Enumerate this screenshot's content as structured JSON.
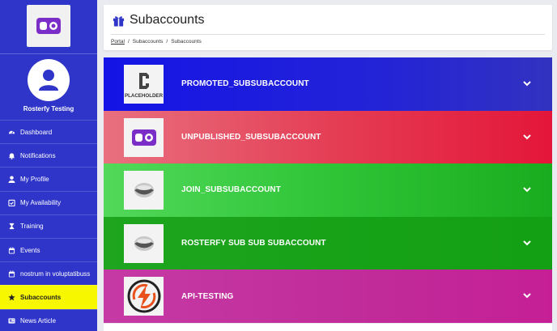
{
  "sidebar": {
    "user_name": "Rosterfy Testing",
    "items": [
      {
        "label": "Dashboard",
        "icon": "dashboard-icon"
      },
      {
        "label": "Notifications",
        "icon": "bell-icon"
      },
      {
        "label": "My Profile",
        "icon": "user-icon"
      },
      {
        "label": "My Availability",
        "icon": "calendar-check-icon"
      },
      {
        "label": "Training",
        "icon": "hourglass-icon"
      },
      {
        "label": "Events",
        "icon": "calendar-icon"
      },
      {
        "label": "nostrum in voluptatibuss",
        "icon": "calendar-icon"
      },
      {
        "label": "Subaccounts",
        "icon": "star-icon",
        "active": true
      },
      {
        "label": "News Article",
        "icon": "newspaper-icon"
      }
    ],
    "active_color": "#f7f700",
    "bg_color": "#2f35c8"
  },
  "header": {
    "title": "Subaccounts",
    "breadcrumb": {
      "portal": "Portal",
      "level2": "Subaccounts",
      "level3": "Subaccounts"
    }
  },
  "cards": [
    {
      "label": "PROMOTED_SUBSUBACCOUNT",
      "thumb": "placeholder-logo",
      "thumb_text": "PLACEHOLDER",
      "color": "#1a1ae0"
    },
    {
      "label": "UNPUBLISHED_SUBSUBACCOUNT",
      "thumb": "rosterfy-logo",
      "color": "#e43a52"
    },
    {
      "label": "JOIN_SUBSUBACCOUNT",
      "thumb": "cloud-logo",
      "color": "#2fc537"
    },
    {
      "label": "ROSTERFY SUB SUB SUBACCOUNT",
      "thumb": "cloud-logo",
      "color": "#17a218"
    },
    {
      "label": "API-TESTING",
      "thumb": "lightning-logo",
      "color": "#c02b99"
    }
  ]
}
